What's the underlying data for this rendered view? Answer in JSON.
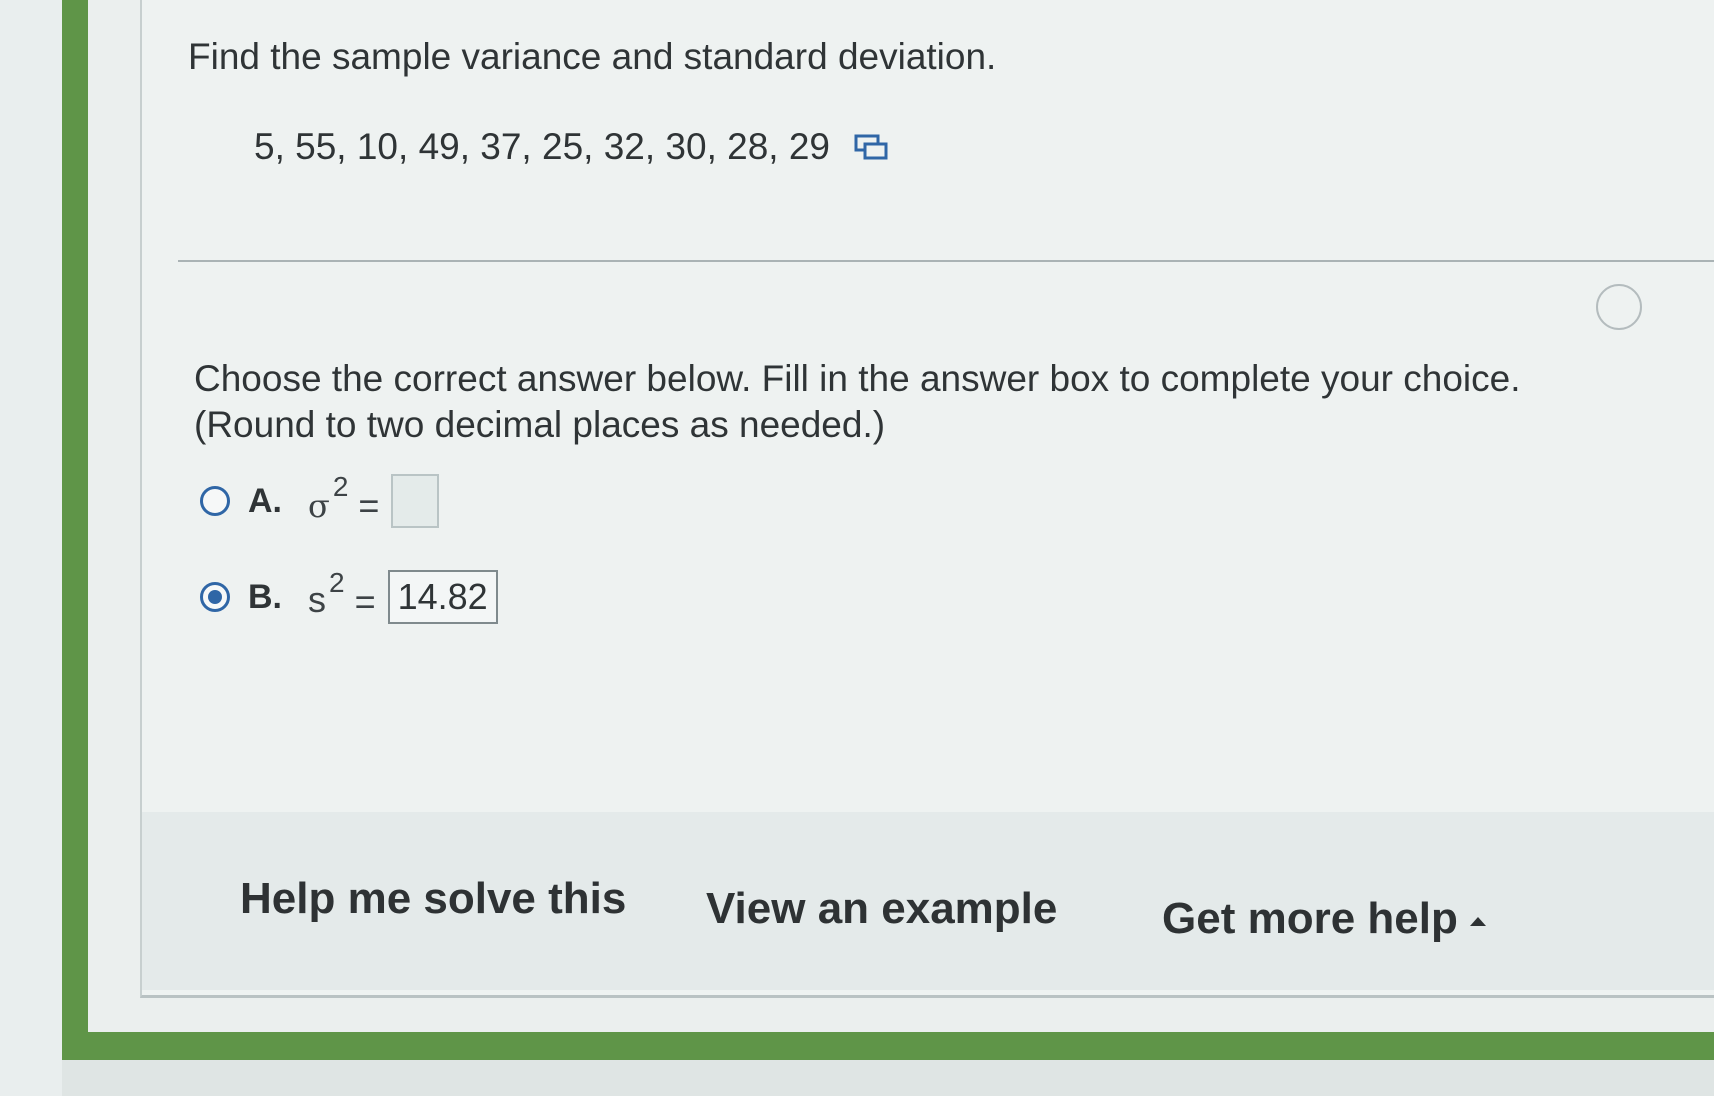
{
  "question": {
    "title": "Find the sample variance and standard deviation.",
    "data_values": "5, 55, 10, 49, 37, 25, 32, 30, 28, 29"
  },
  "instructions": {
    "line1": "Choose the correct answer below. Fill in the answer box to complete your choice.",
    "line2": "(Round to two decimal places as needed.)"
  },
  "options": [
    {
      "letter": "A.",
      "symbol": "σ",
      "exponent": "2",
      "equals": "=",
      "answer": "",
      "selected": false
    },
    {
      "letter": "B.",
      "symbol": "s",
      "exponent": "2",
      "equals": "=",
      "answer": "14.82",
      "selected": true
    }
  ],
  "help": {
    "help_me_solve": "Help me solve this",
    "view_example": "View an example",
    "get_more_help": "Get more help"
  },
  "icons": {
    "copy": "copy-data-icon",
    "caret": "caret-up-icon"
  },
  "colors": {
    "frame": "#5f9548",
    "radio_accent": "#2f66a6"
  }
}
